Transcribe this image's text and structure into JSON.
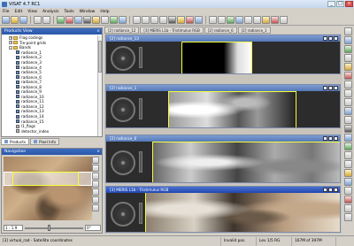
{
  "window": {
    "title": "VISAT 4.7 RC1",
    "controls": [
      "_",
      "□",
      "×"
    ]
  },
  "menu": [
    "File",
    "Edit",
    "View",
    "Analysis",
    "Tools",
    "Window",
    "Help"
  ],
  "products_panel": {
    "title": "Products View",
    "tree": [
      {
        "label": "Flag codings",
        "type": "folder",
        "depth": 1,
        "expander": "+"
      },
      {
        "label": "Tie-point grids",
        "type": "folder",
        "depth": 1,
        "expander": "+"
      },
      {
        "label": "Bands",
        "type": "folder",
        "depth": 1,
        "expander": "-"
      },
      {
        "label": "radiance_1",
        "type": "band",
        "depth": 2
      },
      {
        "label": "radiance_2",
        "type": "band",
        "depth": 2
      },
      {
        "label": "radiance_3",
        "type": "band",
        "depth": 2
      },
      {
        "label": "radiance_4",
        "type": "band",
        "depth": 2
      },
      {
        "label": "radiance_5",
        "type": "band",
        "depth": 2
      },
      {
        "label": "radiance_6",
        "type": "band",
        "depth": 2
      },
      {
        "label": "radiance_7",
        "type": "band",
        "depth": 2
      },
      {
        "label": "radiance_8",
        "type": "band",
        "depth": 2
      },
      {
        "label": "radiance_9",
        "type": "band",
        "depth": 2
      },
      {
        "label": "radiance_10",
        "type": "band",
        "depth": 2
      },
      {
        "label": "radiance_11",
        "type": "band",
        "depth": 2
      },
      {
        "label": "radiance_12",
        "type": "band",
        "depth": 2
      },
      {
        "label": "radiance_13",
        "type": "band",
        "depth": 2
      },
      {
        "label": "radiance_14",
        "type": "band",
        "depth": 2
      },
      {
        "label": "radiance_15",
        "type": "band",
        "depth": 2
      },
      {
        "label": "l1_flags",
        "type": "band",
        "depth": 2
      },
      {
        "label": "detector_index",
        "type": "band",
        "depth": 2
      }
    ]
  },
  "left_tabs": [
    "Products",
    "Pixel Info"
  ],
  "navigation_panel": {
    "title": "Navigation",
    "zoom_value": "1 : 1.9",
    "angle_value": "0°"
  },
  "doc_tabs": [
    "[2] radiance_12",
    "[3] MERIS L1b - Tristimulus RGB",
    "[2] radiance_6",
    "[2] radiance_1"
  ],
  "frames": [
    {
      "title": "[2] radiance_13"
    },
    {
      "title": "[2] radiance_1"
    },
    {
      "title": "[2] radiance_6"
    },
    {
      "title": "[3] MERIS L1b - Tristimulus RGB"
    }
  ],
  "status": {
    "left": "[3] virtual_rad - Satellite coordinates",
    "pos": "Invalid pos.",
    "level": "Lev 1/5 RG",
    "memory": "167M of 397M"
  }
}
